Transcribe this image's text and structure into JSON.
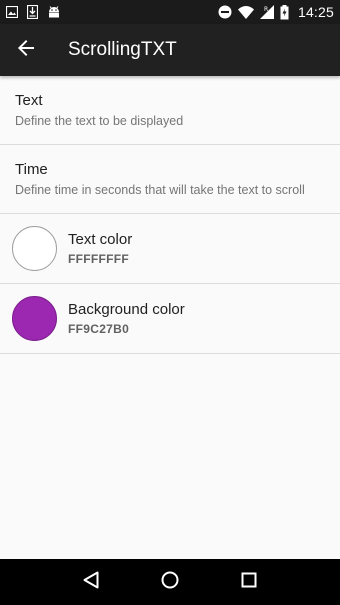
{
  "status_bar": {
    "time": "14:25",
    "left_icons": [
      "image-icon",
      "download-icon",
      "android-icon"
    ],
    "right_icons": [
      "do-not-disturb-icon",
      "wifi-icon",
      "signal-icon",
      "battery-charging-icon"
    ]
  },
  "app_bar": {
    "title": "ScrollingTXT",
    "back_icon": "arrow-back-icon"
  },
  "preferences": [
    {
      "title": "Text",
      "summary": "Define the text to be displayed"
    },
    {
      "title": "Time",
      "summary": "Define time in seconds that will take the text to scroll"
    }
  ],
  "color_preferences": [
    {
      "title": "Text color",
      "value": "FFFFFFFF",
      "swatch": "#ffffff",
      "border": "#9e9e9e"
    },
    {
      "title": "Background color",
      "value": "FF9C27B0",
      "swatch": "#9c27b0",
      "border": "#7b1f8c"
    }
  ],
  "nav_bar": {
    "icons": [
      "back-triangle-icon",
      "home-circle-icon",
      "recents-square-icon"
    ]
  },
  "colors": {
    "status_bar_bg": "#1b1b1b",
    "app_bar_bg": "#212121",
    "background": "#fafafa",
    "divider": "#dcdcdc"
  }
}
